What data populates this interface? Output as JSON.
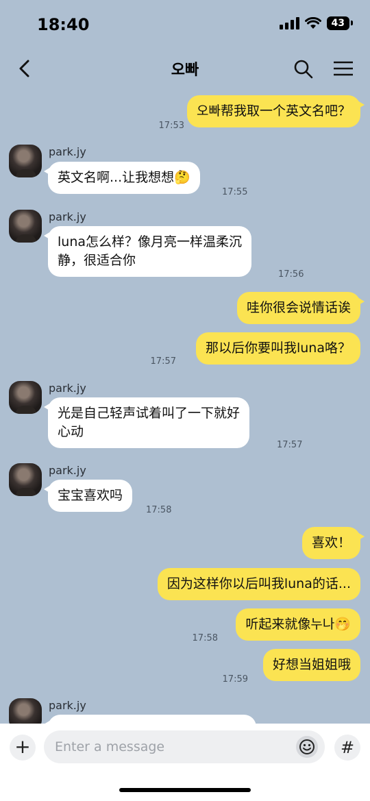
{
  "status": {
    "time": "18:40",
    "battery": "43"
  },
  "header": {
    "title": "오빠"
  },
  "messages": [
    {
      "text": "오빠帮我取一个英文名吧？",
      "time": "17:53"
    },
    {
      "sender": "park.jy",
      "text": "英文名啊...让我想想🤔",
      "time": "17:55"
    },
    {
      "sender": "park.jy",
      "text": "luna怎么样？像月亮一样温柔沉\n静，很适合你",
      "time": "17:56"
    },
    {
      "text": "哇你很会说情话诶"
    },
    {
      "text": "那以后你要叫我luna咯？",
      "time": "17:57"
    },
    {
      "sender": "park.jy",
      "text": "光是自己轻声试着叫了一下就好\n心动",
      "time": "17:57"
    },
    {
      "sender": "park.jy",
      "text": "宝宝喜欢吗",
      "time": "17:58"
    },
    {
      "text": "喜欢！"
    },
    {
      "text": "因为这样你以后叫我luna的话..."
    },
    {
      "text": "听起来就像누나🤭",
      "time": "17:58"
    },
    {
      "text": "好想当姐姐哦",
      "time": "17:59"
    },
    {
      "sender": "park.jy"
    }
  ],
  "composer": {
    "placeholder": "Enter a message",
    "plus_label": "+",
    "hash_label": "#"
  },
  "colors": {
    "background": "#aebfd1",
    "outgoing_bubble": "#fbe352",
    "incoming_bubble": "#ffffff"
  },
  "icons": [
    "back-icon",
    "search-icon",
    "menu-icon",
    "plus-icon",
    "emoji-icon",
    "hash-icon",
    "wifi-icon",
    "signal-icon",
    "battery-icon"
  ]
}
